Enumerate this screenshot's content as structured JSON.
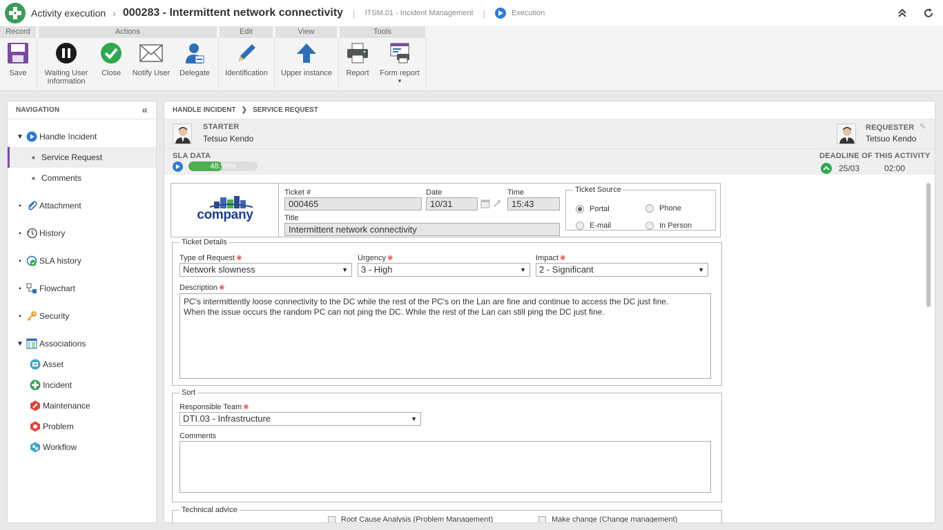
{
  "header": {
    "app_title": "Activity execution",
    "separator": "›",
    "record_title": "000283 - Intermittent network connectivity",
    "pipe": "|",
    "process": "ITSM.01 - Incident Management",
    "state": "Execution"
  },
  "ribbon": {
    "groups": {
      "record": "Record",
      "actions": "Actions",
      "edit": "Edit",
      "view": "View",
      "tools": "Tools"
    },
    "save": "Save",
    "waiting_user_info_1": "Waiting User",
    "waiting_user_info_2": "Information",
    "close": "Close",
    "notify_user": "Notify User",
    "delegate": "Delegate",
    "identification": "Identification",
    "upper_instance": "Upper instance",
    "report": "Report",
    "form_report": "Form report"
  },
  "navigation": {
    "title": "NAVIGATION",
    "items": [
      {
        "label": "Handle Incident",
        "icon": "play-circle-icon"
      },
      {
        "label": "Service Request",
        "icon": ""
      },
      {
        "label": "Comments",
        "icon": ""
      },
      {
        "label": "Attachment",
        "icon": "paperclip-icon"
      },
      {
        "label": "History",
        "icon": "history-icon"
      },
      {
        "label": "SLA history",
        "icon": "sla-history-icon"
      },
      {
        "label": "Flowchart",
        "icon": "flowchart-icon"
      },
      {
        "label": "Security",
        "icon": "key-icon"
      },
      {
        "label": "Associations",
        "icon": "associations-icon"
      },
      {
        "label": "Asset",
        "icon": "asset-icon"
      },
      {
        "label": "Incident",
        "icon": "incident-icon"
      },
      {
        "label": "Maintenance",
        "icon": "maintenance-icon"
      },
      {
        "label": "Problem",
        "icon": "problem-icon"
      },
      {
        "label": "Workflow",
        "icon": "workflow-icon"
      }
    ]
  },
  "breadcrumb": {
    "level1": "HANDLE INCIDENT",
    "level2": "SERVICE REQUEST"
  },
  "starter": {
    "label": "STARTER",
    "name": "Tetsuo Kendo"
  },
  "requester": {
    "label": "REQUESTER",
    "name": "Tetsuo Kendo"
  },
  "sla": {
    "label": "SLA DATA",
    "progress_text": "48.99%",
    "progress": 0.4899,
    "deadline_label": "DEADLINE OF THIS ACTIVITY",
    "deadline_date": "25/03",
    "deadline_time": "02:00"
  },
  "ticket": {
    "logo_text": "company",
    "number_label": "Ticket #",
    "number": "000465",
    "date_label": "Date",
    "date": "10/31",
    "time_label": "Time",
    "time": "15:43",
    "title_label": "Title",
    "title": "Intermittent network connectivity",
    "source_legend": "Ticket Source",
    "sources": [
      "Portal",
      "Phone",
      "E-mail",
      "In Person"
    ],
    "source_selected": "Portal"
  },
  "details": {
    "legend": "Ticket Details",
    "type_label": "Type of Request",
    "type_value": "Network slowness",
    "urgency_label": "Urgency",
    "urgency_value": "3 - High",
    "impact_label": "Impact",
    "impact_value": "2 - Significant",
    "description_label": "Description",
    "description_line1": "PC's intermittently loose connectivity to the DC while the rest of the PC's on the Lan are fine and continue to access the DC just fine.",
    "description_line2": "When the issue occurs the random PC can not ping the DC. While the rest of the Lan can still ping the DC just fine."
  },
  "sort": {
    "legend": "Sort",
    "team_label": "Responsible Team",
    "team_value": "DTI.03 - Infrastructure",
    "comments_label": "Comments",
    "comments_value": ""
  },
  "technical": {
    "legend": "Technical advice",
    "option1": "Root Cause Analysis (Problem Management)",
    "option2": "Make change (Change management)"
  },
  "colors": {
    "accent_purple": "#7b4c9c",
    "brand_green": "#3d9a5b",
    "sla_green": "#4caf50",
    "execution_blue": "#2e7bcf"
  }
}
